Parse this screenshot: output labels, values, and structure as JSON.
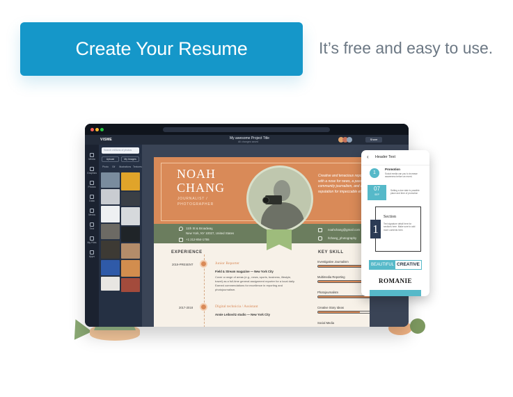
{
  "hero": {
    "cta_label": "Create Your Resume",
    "tagline": "It’s free and easy to use."
  },
  "colors": {
    "cta": "#1597c9",
    "tagline": "#6c7884",
    "resume_orange": "#d98a58",
    "resume_green": "#6b7d5e",
    "editor_dark": "#1c2330",
    "accent_teal": "#56b9c9"
  },
  "editor": {
    "brand": "VISME",
    "project_title": "My awesome Project Title",
    "project_sub": "All changes saved",
    "share_label": "Share",
    "rail_items": [
      "Media",
      "Graphics",
      "Photos",
      "Data",
      "Media",
      "Text",
      "My Files",
      "Apps"
    ],
    "search_placeholder": "Search millions of photos",
    "upload_label": "Upload",
    "my_images_label": "My Images",
    "panel_tabs": [
      "Photo",
      "Gif",
      "Illustrations",
      "Textures"
    ]
  },
  "resume": {
    "first_name": "NOAH",
    "last_name": "CHANG",
    "title_line1": "JOURNALIST /",
    "title_line2": "PHOTOGRAPHER",
    "quote": "Creative and tenacious reporter with a nose for news, a passion for community journalism, and a reputation for impeccable ethics.",
    "address_line1": "11th St & Broadway,",
    "address_line2": "New York, NY 10027, United States",
    "phone": "+1 212-854-1755",
    "email": "noahchang@gmail.com",
    "social": "/tchang_photography",
    "experience_heading": "EXPERIENCE",
    "skills_heading": "KEY SKILL",
    "experience": [
      {
        "date": "2019-PRESENT",
        "role": "Junior Reporter",
        "company": "Field & Stream magazine — New York City",
        "desc": "Cover a range of areas (e.g., news, sports, business, lifestyle, travel) as a full-time general assignment reporter for a local daily. Earned commendations for excellence in reporting and photojournalism."
      },
      {
        "date": "2017-2018",
        "role": "Digital technicia / Assistant",
        "company": "Annie Leibovitz studio — New York City",
        "desc": ""
      }
    ],
    "skills": [
      {
        "label": "Investigative Journalism",
        "level": 0.82
      },
      {
        "label": "Multimedia Reporting",
        "level": 0.74
      },
      {
        "label": "Photojournalism",
        "level": 0.88
      },
      {
        "label": "Creative Story Ideas",
        "level": 0.7
      },
      {
        "label": "Social Media",
        "level": 0.78
      }
    ]
  },
  "phone": {
    "header": "Header Text",
    "step_number": "1",
    "promo_heading": "Promotion",
    "promo_text": "Social media can you to increase awareness before an event.",
    "date_day": "07",
    "date_month": "SEP",
    "date_text": "Setting a due date is possible place and time of promotion",
    "section_number": "1",
    "section_heading": "Section",
    "section_text": "Text signature detail here for sections here. Make sure to add more contents here.",
    "beautiful_label": "BEAUTIFUL",
    "creative_label": "CREATIVE",
    "romanie_label": "ROMANIE"
  }
}
